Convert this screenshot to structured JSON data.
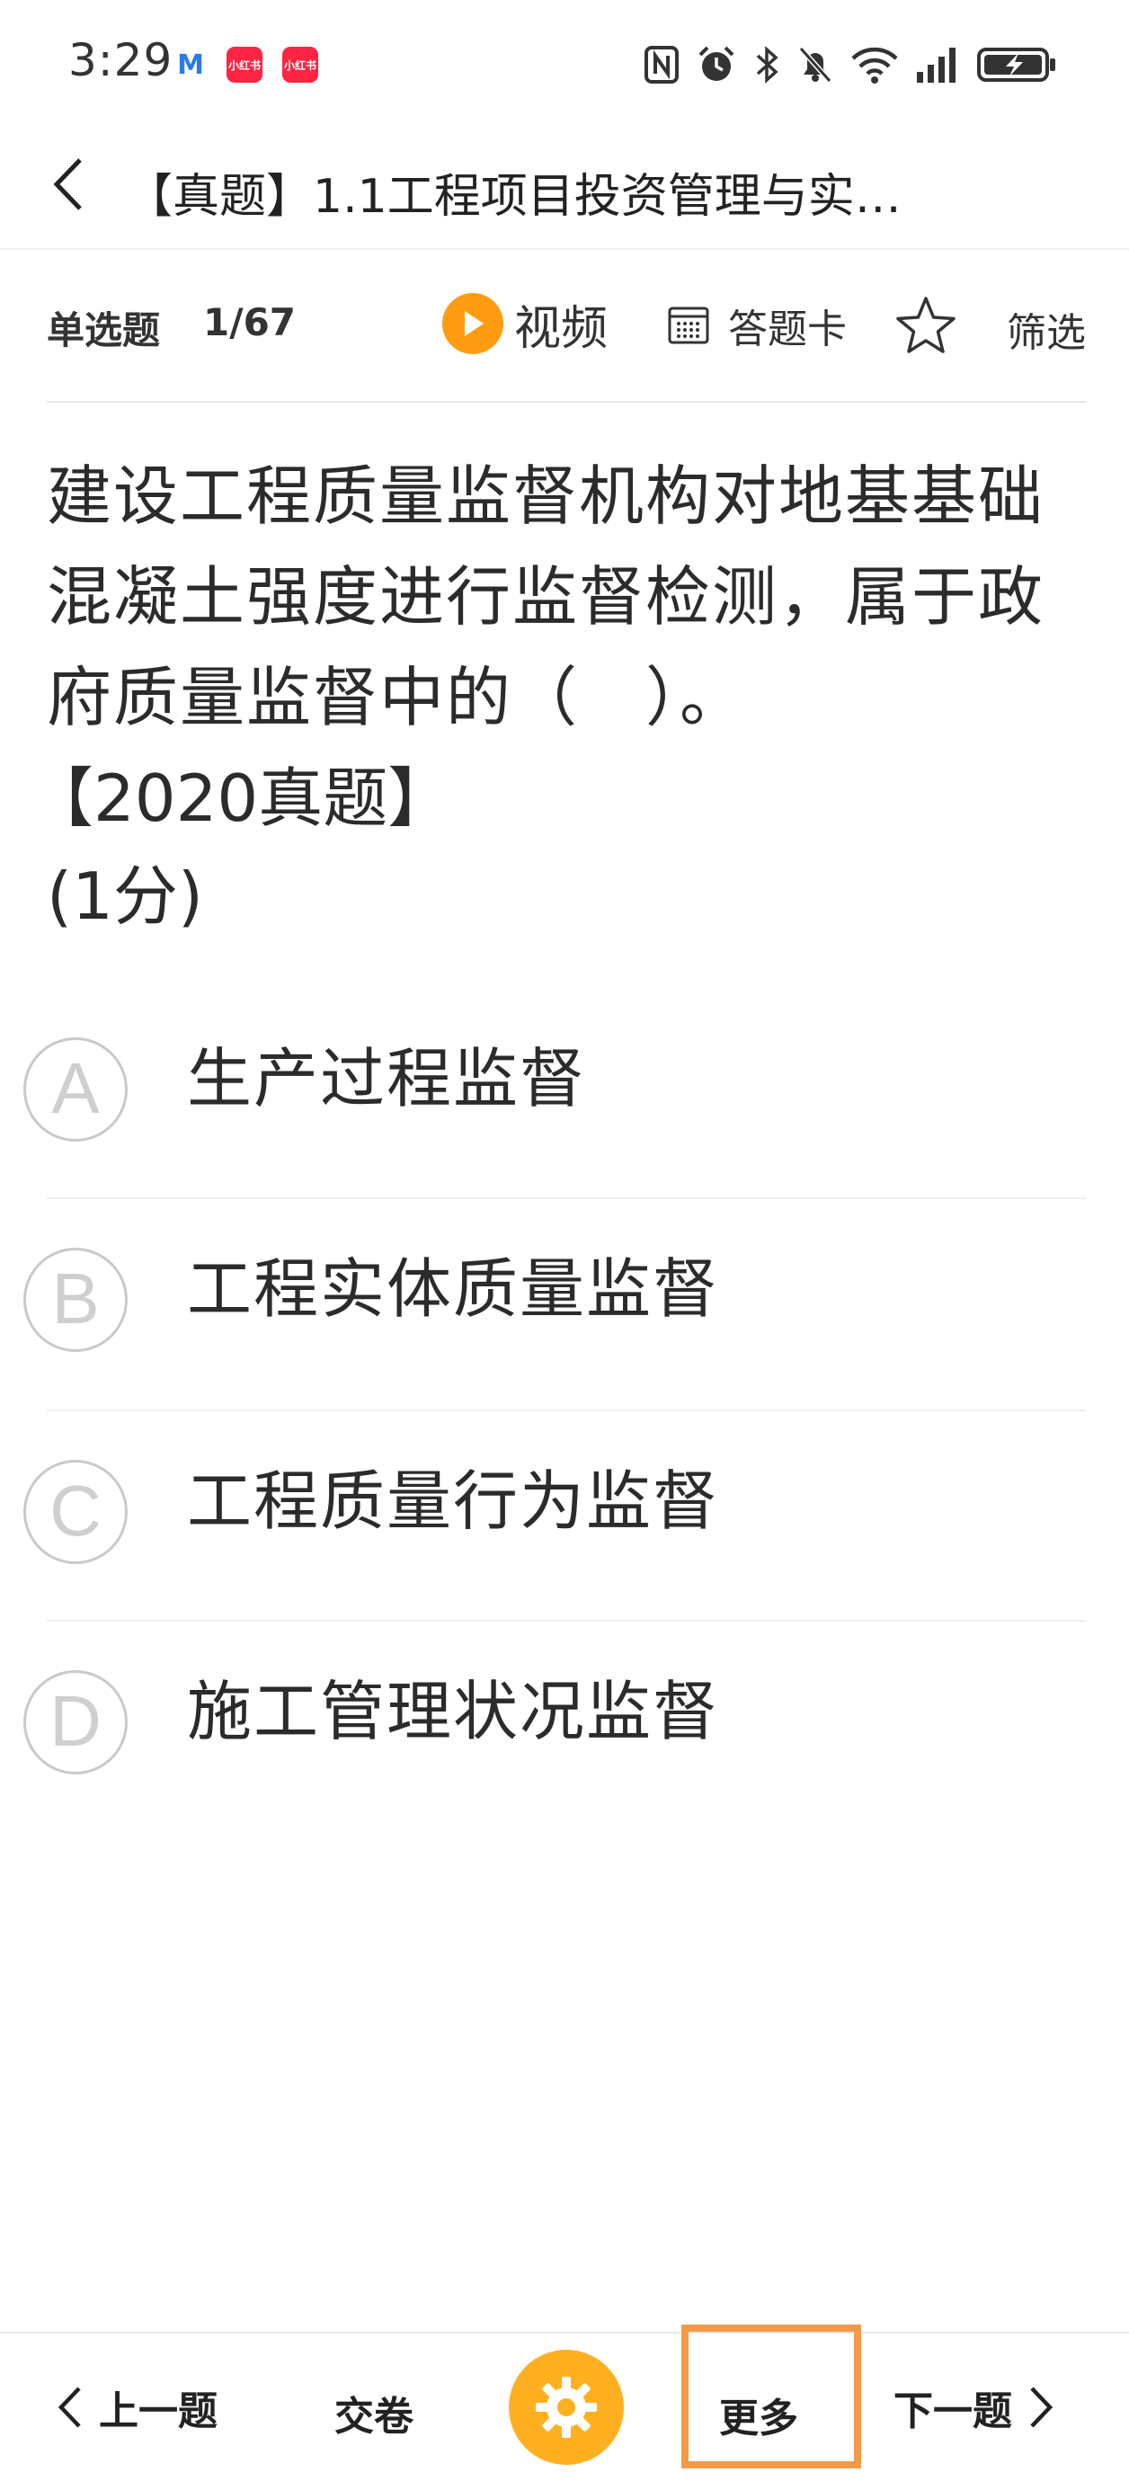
{
  "status_bar": {
    "time": "3:29",
    "app_badge_1": "M",
    "app_badge_2": "小红书",
    "app_badge_3": "小红书"
  },
  "header": {
    "title": "【真题】1.1工程项目投资管理与实…"
  },
  "toolbar": {
    "question_type": "单选题",
    "question_index": "1/67",
    "video_label": "视频",
    "answer_card_label": "答题卡",
    "filter_label": "筛选"
  },
  "question": {
    "text": "建设工程质量监督机构对地基基础混凝土强度进行监督检测，属于政府质量监督中的（　）。",
    "source": "【2020真题】",
    "score": "(1分)"
  },
  "options": [
    {
      "letter": "A",
      "text": "生产过程监督"
    },
    {
      "letter": "B",
      "text": "工程实体质量监督"
    },
    {
      "letter": "C",
      "text": "工程质量行为监督"
    },
    {
      "letter": "D",
      "text": "施工管理状况监督"
    }
  ],
  "bottom_bar": {
    "prev_label": "上一题",
    "submit_label": "交卷",
    "more_label": "更多",
    "next_label": "下一题"
  },
  "colors": {
    "accent_orange": "#ff9c12",
    "gear_orange": "#ffb020",
    "highlight_border": "#f29a48",
    "option_circle": "#c9c9c9"
  }
}
